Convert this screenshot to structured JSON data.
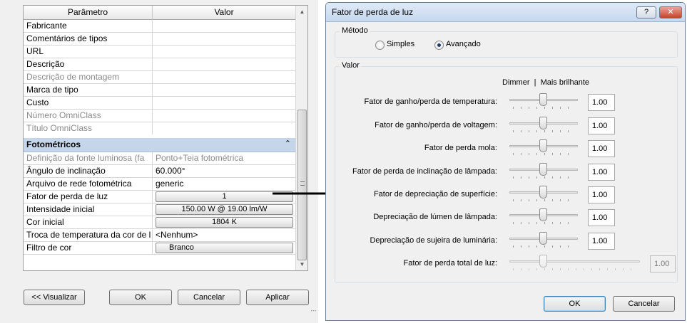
{
  "properties": {
    "header": {
      "param": "Parâmetro",
      "value": "Valor"
    },
    "rows": [
      {
        "name": "Fabricante",
        "value": ""
      },
      {
        "name": "Comentários de tipos",
        "value": ""
      },
      {
        "name": "URL",
        "value": ""
      },
      {
        "name": "Descrição",
        "value": ""
      },
      {
        "name": "Descrição de montagem",
        "value": ""
      },
      {
        "name": "Marca de tipo",
        "value": ""
      },
      {
        "name": "Custo",
        "value": ""
      },
      {
        "name": "Número OmniClass",
        "value": ""
      },
      {
        "name": "Título OmniClass",
        "value": ""
      }
    ],
    "group": {
      "title": "Fotométricos",
      "collapse_glyph": "⌃"
    },
    "photometric_rows": [
      {
        "name": "Definição da fonte luminosa (fa",
        "value": "Ponto+Teia fotométrica"
      },
      {
        "name": "Ângulo de inclinação",
        "value": "60.000°"
      },
      {
        "name": "Arquivo de rede fotométrica",
        "value": "generic"
      },
      {
        "name": "Fator de perda de luz",
        "value": "1"
      },
      {
        "name": "Intensidade inicial",
        "value": "150.00 W @ 19.00 lm/W"
      },
      {
        "name": "Cor inicial",
        "value": "1804 K"
      },
      {
        "name": "Troca de temperatura da cor de l",
        "value": "<Nenhum>"
      },
      {
        "name": "Filtro de cor",
        "value": "Branco"
      }
    ],
    "buttons": {
      "preview": "<< Visualizar",
      "ok": "OK",
      "cancel": "Cancelar",
      "apply": "Aplicar"
    }
  },
  "dialog": {
    "title": "Fator de perda de luz",
    "help": "?",
    "close": "✕",
    "method": {
      "legend": "Método",
      "options": [
        {
          "label": "Simples",
          "selected": false
        },
        {
          "label": "Avançado",
          "selected": true
        }
      ]
    },
    "values": {
      "legend": "Valor",
      "scale_header": "Dimmer  |  Mais brilhante",
      "sliders": [
        {
          "label": "Fator de ganho/perda de temperatura:",
          "value": "1.00",
          "level": 0.5
        },
        {
          "label": "Fator de ganho/perda de voltagem:",
          "value": "1.00",
          "level": 0.5
        },
        {
          "label": "Fator de perda mola:",
          "value": "1.00",
          "level": 0.5
        },
        {
          "label": "Fator de perda de inclinação de lâmpada:",
          "value": "1.00",
          "level": 0.5
        },
        {
          "label": "Fator de depreciação de superfície:",
          "value": "1.00",
          "level": 0.5
        },
        {
          "label": "Depreciação de lúmen de lâmpada:",
          "value": "1.00",
          "level": 0.5
        },
        {
          "label": "Depreciação de sujeira de luminária:",
          "value": "1.00",
          "level": 0.5
        }
      ],
      "total": {
        "label": "Fator de perda total de luz:",
        "value": "1.00",
        "level": 0.25
      }
    },
    "buttons": {
      "ok": "OK",
      "cancel": "Cancelar"
    }
  }
}
